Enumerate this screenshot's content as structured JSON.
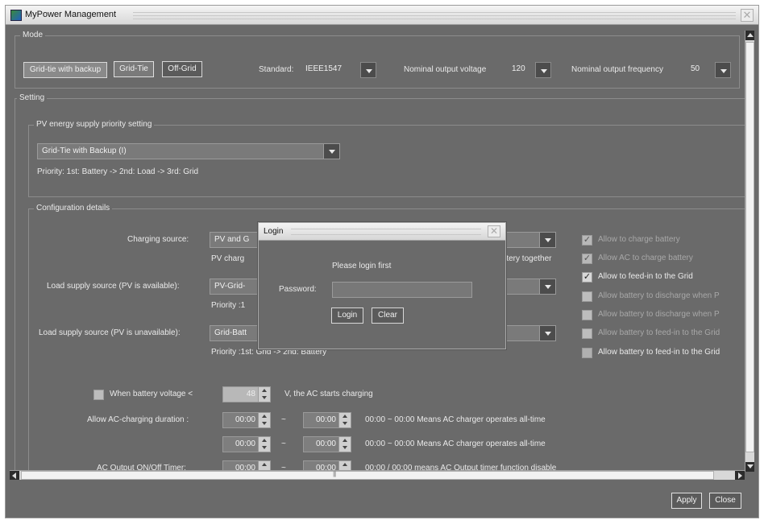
{
  "window": {
    "title": "MyPower Management"
  },
  "mode": {
    "legend": "Mode",
    "buttons": [
      "Grid-tie with backup",
      "Grid-Tie",
      "Off-Grid"
    ],
    "standard_label": "Standard:",
    "standard_value": "IEEE1547",
    "voltage_label": "Nominal output voltage",
    "voltage_value": "120",
    "frequency_label": "Nominal output frequency",
    "frequency_value": "50"
  },
  "setting": {
    "legend": "Setting",
    "pv_group": {
      "legend": "PV energy supply priority setting",
      "value": "Grid-Tie with Backup (I)",
      "priority_text": "Priority: 1st: Battery -> 2nd: Load -> 3rd: Grid"
    },
    "config": {
      "legend": "Configuration details",
      "charging_label": "Charging source:",
      "charging_value": "PV and G",
      "charging_note_left": "PV charg",
      "charging_note_right": "attery together",
      "load_pv_label": "Load supply source (PV is available):",
      "load_pv_value": "PV-Grid-",
      "load_pv_priority": "Priority :1",
      "load_nopv_label": "Load supply source (PV is unavailable):",
      "load_nopv_value": "Grid-Batt",
      "load_nopv_priority": "Priority :1st: Grid -> 2nd: Battery",
      "checkboxes": [
        {
          "label": "Allow to charge battery",
          "checked": true,
          "enabled": false
        },
        {
          "label": "Allow AC to charge battery",
          "checked": true,
          "enabled": false
        },
        {
          "label": "Allow to feed-in to the Grid",
          "checked": true,
          "enabled": true
        },
        {
          "label": "Allow battery to discharge when P",
          "checked": false,
          "enabled": false
        },
        {
          "label": "Allow battery to discharge when P",
          "checked": false,
          "enabled": false
        },
        {
          "label": "Allow battery to feed-in to the Grid",
          "checked": false,
          "enabled": false
        },
        {
          "label": "Allow battery to feed-in to the Grid",
          "checked": false,
          "enabled": true
        }
      ]
    },
    "battery": {
      "label": "When battery voltage <",
      "value": "48",
      "suffix": "V,  the AC starts charging"
    },
    "ac_duration": {
      "label": "Allow AC-charging duration :",
      "rows": [
        {
          "start": "00:00",
          "sep": "~",
          "end": "00:00",
          "note": "00:00 ~ 00:00 Means AC charger operates all-time"
        },
        {
          "start": "00:00",
          "sep": "~",
          "end": "00:00",
          "note": "00:00 ~ 00:00 Means AC charger operates all-time"
        }
      ]
    },
    "ac_output": {
      "label": "AC Output ON/Off Timer:",
      "start": "00:00",
      "sep": "~",
      "end": "00:00",
      "note": "00:00 / 00:00 means AC Output timer function disable"
    }
  },
  "login": {
    "title": "Login",
    "message": "Please login first",
    "password_label": "Password:",
    "password_value": "",
    "login_button": "Login",
    "clear_button": "Clear"
  },
  "footer": {
    "apply": "Apply",
    "close": "Close"
  }
}
